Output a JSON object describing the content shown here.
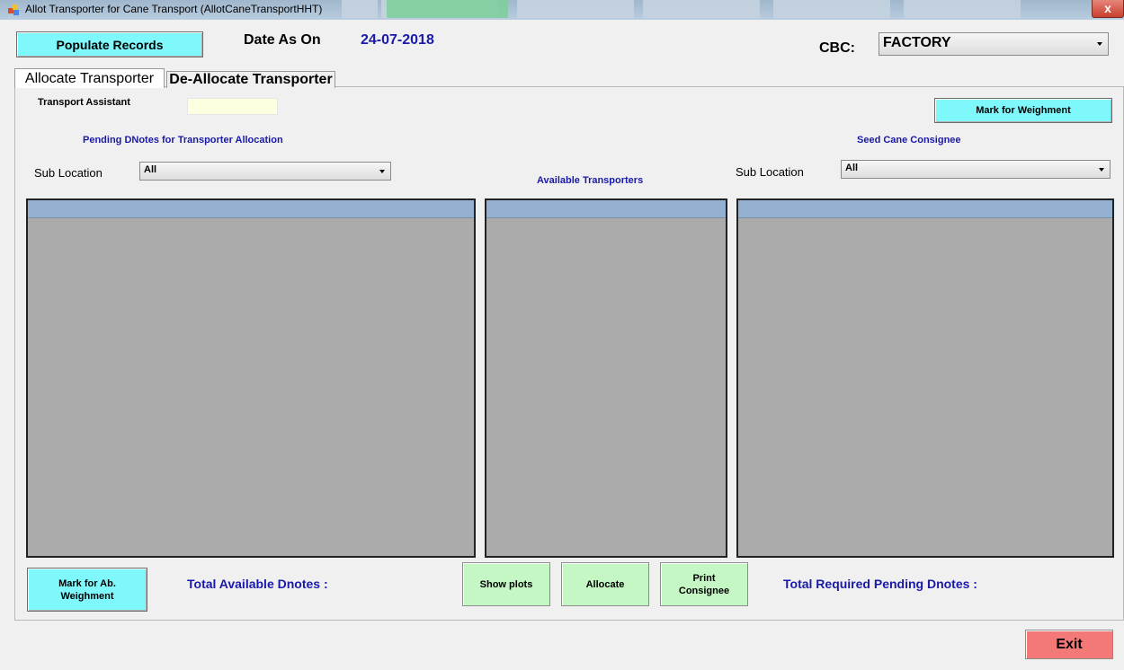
{
  "window": {
    "title": "Allot Transporter for Cane Transport (AllotCaneTransportHHT)",
    "close_label": "x"
  },
  "header": {
    "populate_label": "Populate Records",
    "date_label": "Date As On",
    "date_value": "24-07-2018",
    "cbc_label": "CBC:",
    "cbc_value": "FACTORY"
  },
  "tabs": [
    {
      "label": "Allocate Transporter",
      "selected": true
    },
    {
      "label": "De-Allocate Transporter",
      "selected": false
    }
  ],
  "allocate": {
    "transport_assistant_label": "Transport Assistant",
    "transport_assistant_value": "",
    "mark_weighment_label": "Mark for Weighment",
    "pending_title": "Pending DNotes for Transporter Allocation",
    "seed_title": "Seed Cane Consignee",
    "available_title": "Available Transporters",
    "sub_location_label": "Sub Location",
    "sub_location_left_value": "All",
    "sub_location_right_value": "All",
    "mark_ab_label": "Mark for Ab. Weighment",
    "total_available_label": "Total Available Dnotes :",
    "show_plots_label": "Show plots",
    "allocate_label": "Allocate",
    "print_consignee_label": "Print Consignee",
    "total_required_label": "Total Required Pending Dnotes :"
  },
  "footer": {
    "exit_label": "Exit"
  },
  "colors": {
    "cyan_button": "#7ff8fc",
    "green_button": "#c5f7c5",
    "exit_button": "#f37878",
    "label_blue": "#1a1aa8",
    "grid_header": "#95b1d1",
    "grid_body": "#ababab"
  }
}
